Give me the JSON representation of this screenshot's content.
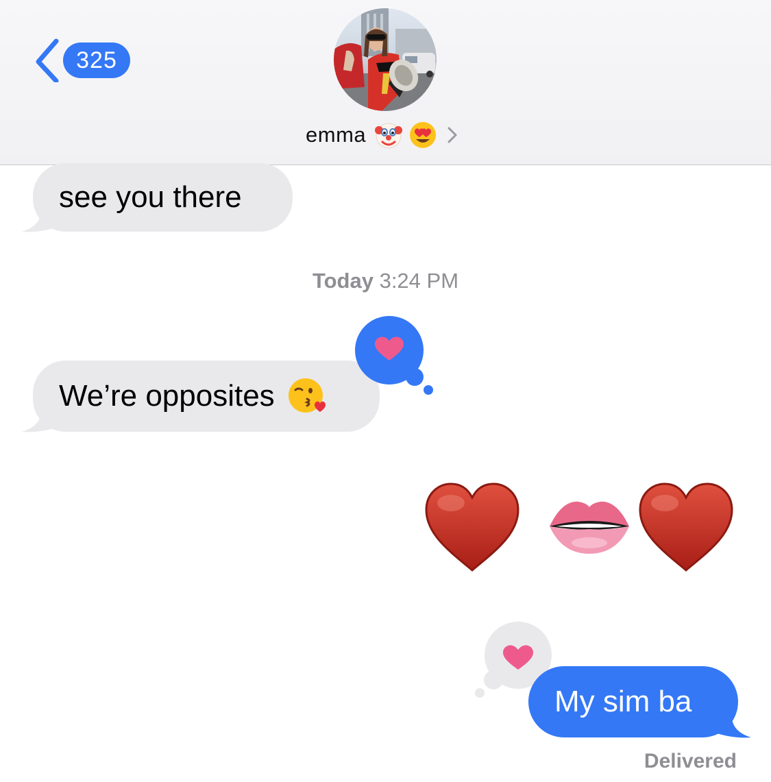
{
  "header": {
    "back_count": "325",
    "contact_name": "emma",
    "contact_emojis": [
      "clown-face-emoji",
      "heart-eyes-emoji"
    ],
    "chevron": ">"
  },
  "messages": [
    {
      "direction": "incoming",
      "text": "see you there"
    },
    {
      "type": "timestamp",
      "day": "Today",
      "time": "3:24 PM"
    },
    {
      "direction": "incoming",
      "text": "We’re opposites",
      "emoji": "face-blowing-kiss-emoji",
      "tapback": "heart"
    },
    {
      "direction": "outgoing",
      "type": "big-emoji",
      "emojis": [
        "red-heart",
        "mouth",
        "red-heart"
      ]
    },
    {
      "direction": "outgoing",
      "text": "My sim ba",
      "tapback": "heart"
    }
  ],
  "status": {
    "delivered": "Delivered"
  },
  "colors": {
    "ios_blue": "#3478f6",
    "incoming_bubble": "#e9e9eb",
    "tapback_heart": "#ef5a8c",
    "muted_text": "#8e8e93"
  }
}
